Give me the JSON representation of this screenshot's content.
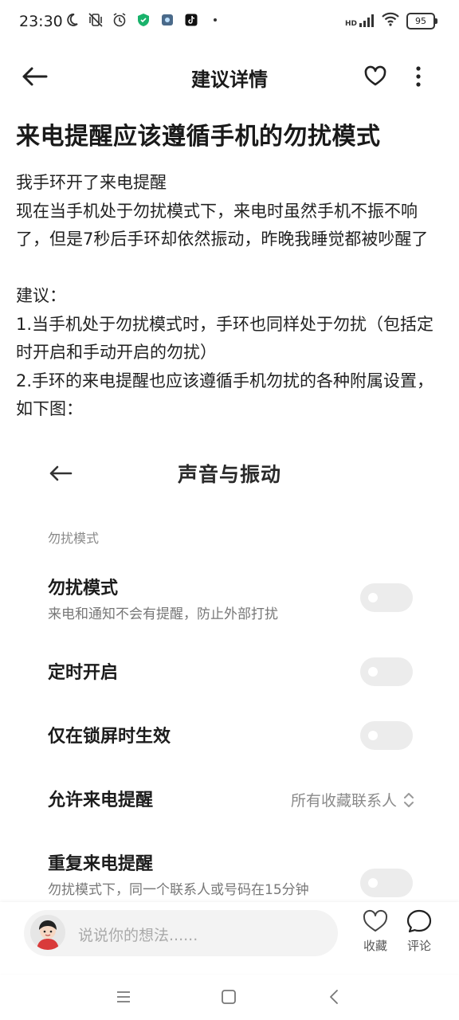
{
  "status": {
    "time": "23:30",
    "battery": "95",
    "network": "HD"
  },
  "app_bar": {
    "title": "建议详情"
  },
  "article": {
    "title": "来电提醒应该遵循手机的勿扰模式",
    "paragraphs": [
      "我手环开了来电提醒",
      "现在当手机处于勿扰模式下，来电时虽然手机不振不响了，但是7秒后手环却依然振动，昨晚我睡觉都被吵醒了",
      "",
      "建议：",
      "1.当手机处于勿扰模式时，手环也同样处于勿扰（包括定时开启和手动开启的勿扰）",
      "2.手环的来电提醒也应该遵循手机勿扰的各种附属设置，如下图："
    ]
  },
  "embedded": {
    "title": "声音与振动",
    "section": "勿扰模式",
    "rows": [
      {
        "title": "勿扰模式",
        "subtitle": "来电和通知不会有提醒，防止外部打扰",
        "toggle": false
      },
      {
        "title": "定时开启",
        "toggle": false
      },
      {
        "title": "仅在锁屏时生效",
        "toggle": false
      },
      {
        "title": "允许来电提醒",
        "value": "所有收藏联系人"
      },
      {
        "title": "重复来电提醒",
        "subtitle": "勿扰模式下，同一个联系人或号码在15分钟",
        "toggle": false
      }
    ]
  },
  "bottom": {
    "comment_placeholder": "说说你的想法......",
    "favorite_label": "收藏",
    "comment_label": "评论"
  },
  "colors": {
    "toggle_off": "#ececec",
    "secondary_text": "#8a8a8a",
    "input_bg": "#f3f3f3"
  }
}
